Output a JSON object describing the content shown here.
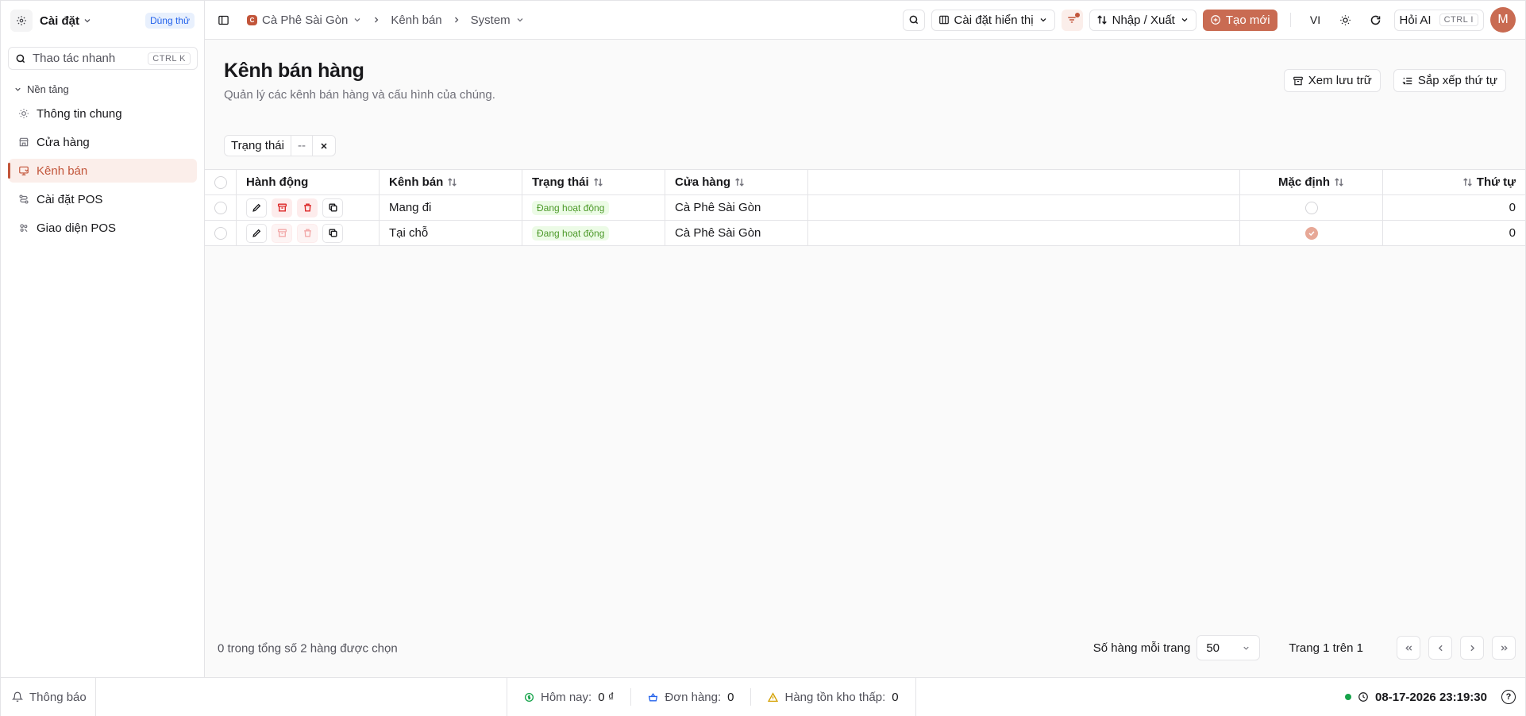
{
  "sidebar": {
    "title": "Cài đặt",
    "trial_badge": "Dùng thử",
    "quick_search": {
      "placeholder": "Thao tác nhanh",
      "shortcut": "CTRL K"
    },
    "group_label": "Nền tảng",
    "items": [
      {
        "label": "Thông tin chung",
        "icon": "sun-icon"
      },
      {
        "label": "Cửa hàng",
        "icon": "store-icon"
      },
      {
        "label": "Kênh bán",
        "icon": "channel-icon",
        "active": true
      },
      {
        "label": "Cài đặt POS",
        "icon": "route-icon"
      },
      {
        "label": "Giao diện POS",
        "icon": "palette-icon"
      }
    ]
  },
  "topbar": {
    "breadcrumb": [
      {
        "label": "Cà Phê Sài Gòn",
        "badge": "C"
      },
      {
        "label": "Kênh bán"
      },
      {
        "label": "System"
      }
    ],
    "display_settings": "Cài đặt hiển thị",
    "import_export": "Nhập / Xuất",
    "create_new": "Tạo mới",
    "language": "VI",
    "ask_ai": "Hỏi AI",
    "ask_ai_shortcut": "CTRL I",
    "avatar_initial": "M"
  },
  "page": {
    "title": "Kênh bán hàng",
    "subtitle": "Quản lý các kênh bán hàng và cấu hình của chúng.",
    "view_archive": "Xem lưu trữ",
    "sort_order": "Sắp xếp thứ tự",
    "filter": {
      "label": "Trạng thái",
      "value": "--"
    }
  },
  "table": {
    "columns": {
      "actions": "Hành động",
      "channel": "Kênh bán",
      "status": "Trạng thái",
      "store": "Cửa hàng",
      "default": "Mặc định",
      "order": "Thứ tự"
    },
    "rows": [
      {
        "channel": "Mang đi",
        "status": "Đang hoạt động",
        "store": "Cà Phê Sài Gòn",
        "is_default": false,
        "order": "0"
      },
      {
        "channel": "Tại chỗ",
        "status": "Đang hoạt động",
        "store": "Cà Phê Sài Gòn",
        "is_default": true,
        "order": "0"
      }
    ],
    "selection_info": "0 trong tổng số 2 hàng được chọn",
    "rows_per_page_label": "Số hàng mỗi trang",
    "rows_per_page": "50",
    "page_info": "Trang 1 trên 1"
  },
  "statusbar": {
    "notifications": "Thông báo",
    "today_label": "Hôm nay:",
    "today_value": "0 ₫",
    "orders_label": "Đơn hàng:",
    "orders_value": "0",
    "low_stock_label": "Hàng tồn kho thấp:",
    "low_stock_value": "0",
    "datetime": "08-17-2026 23:19:30",
    "help": "?"
  },
  "colors": {
    "accent": "#c96b52",
    "active_bg": "#fbeeea",
    "success": "#4d9a2a",
    "info": "#2563eb"
  }
}
